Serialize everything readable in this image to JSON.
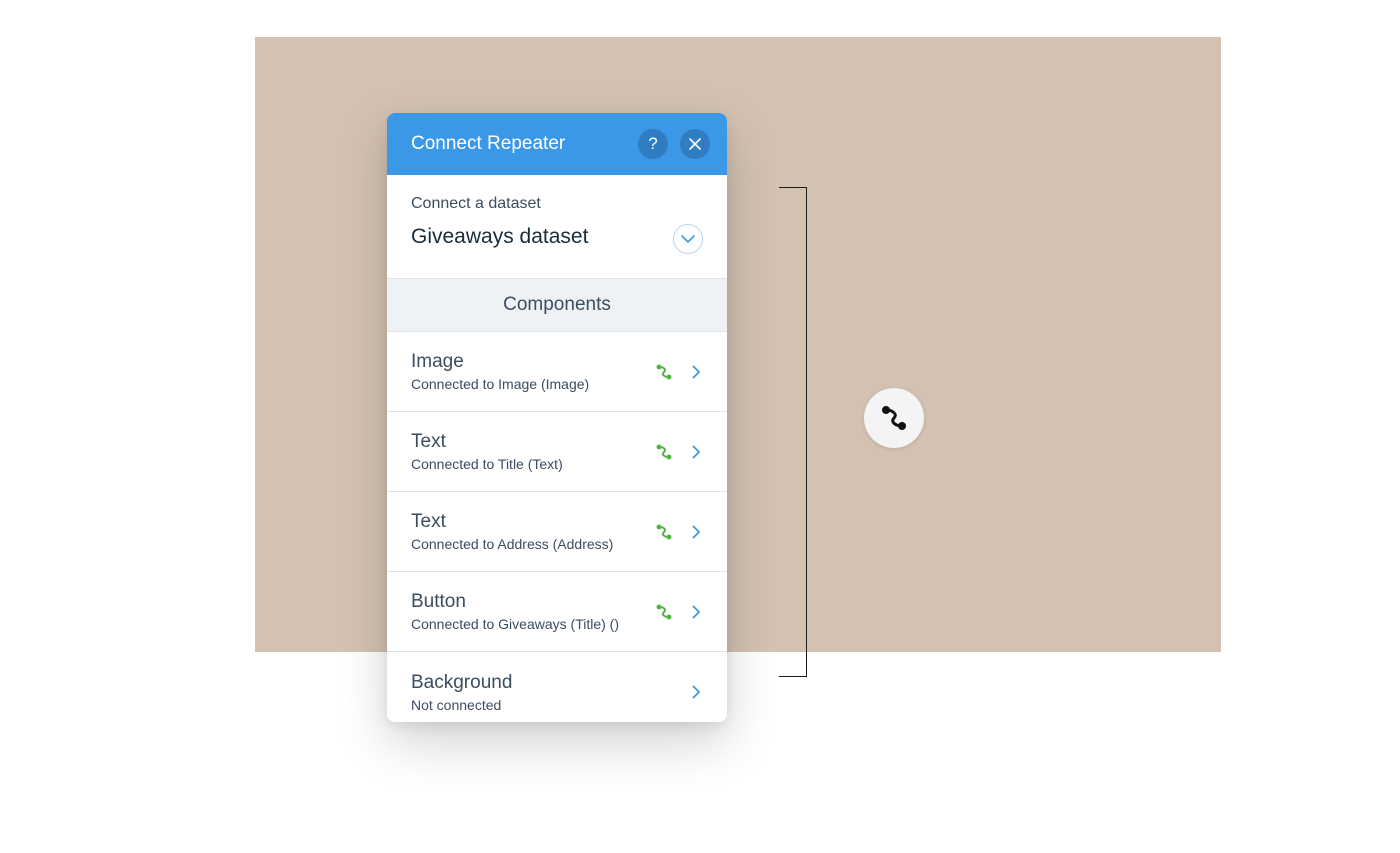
{
  "panel": {
    "title": "Connect Repeater",
    "help_icon": "question-mark-icon",
    "close_icon": "close-icon"
  },
  "dataset": {
    "label": "Connect a dataset",
    "value": "Giveaways dataset"
  },
  "components": {
    "header": "Components",
    "items": [
      {
        "name": "Image",
        "status": "Connected to Image (Image)",
        "connected": true
      },
      {
        "name": "Text",
        "status": "Connected to Title (Text)",
        "connected": true
      },
      {
        "name": "Text",
        "status": "Connected to Address (Address)",
        "connected": true
      },
      {
        "name": "Button",
        "status": "Connected to Giveaways (Title) ()",
        "connected": true
      },
      {
        "name": "Background",
        "status": "Not connected",
        "connected": false
      }
    ]
  },
  "colors": {
    "header": "#3b98e6",
    "connected_icon": "#4fb443",
    "chevron": "#3b98e6",
    "canvas": "#d3c2b1"
  }
}
